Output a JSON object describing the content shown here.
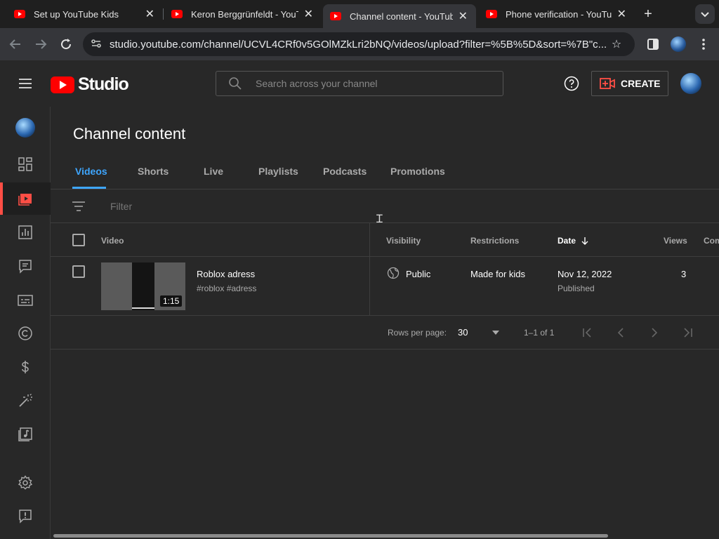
{
  "browser": {
    "tabs": [
      {
        "title": "Set up YouTube Kids",
        "active": false
      },
      {
        "title": "Keron Berggrünfeldt - YouT",
        "active": false
      },
      {
        "title": "Channel content - YouTube",
        "active": true
      },
      {
        "title": "Phone verification - YouTub",
        "active": false
      }
    ],
    "new_tab": "+",
    "url": "studio.youtube.com/channel/UCVL4CRf0v5GOlMZkLri2bNQ/videos/upload?filter=%5B%5D&sort=%7B\"c..."
  },
  "studio": {
    "logo_text": "Studio",
    "search_placeholder": "Search across your channel",
    "create_label": "CREATE"
  },
  "page": {
    "title": "Channel content",
    "tabs": [
      "Videos",
      "Shorts",
      "Live",
      "Playlists",
      "Podcasts",
      "Promotions"
    ],
    "filter_placeholder": "Filter"
  },
  "table": {
    "headers": {
      "video": "Video",
      "visibility": "Visibility",
      "restrictions": "Restrictions",
      "date": "Date",
      "views": "Views",
      "comments": "Com"
    },
    "rows": [
      {
        "title": "Roblox adress",
        "description": "#roblox #adress",
        "duration": "1:15",
        "visibility": "Public",
        "restrictions": "Made for kids",
        "date": "Nov 12, 2022",
        "status": "Published",
        "views": "3"
      }
    ]
  },
  "pager": {
    "rows_label": "Rows per page:",
    "rows_value": "30",
    "range": "1–1 of 1"
  },
  "colors": {
    "accent": "#3ea6ff",
    "brand_red": "#ff0000",
    "active_marker": "#ff4e45"
  }
}
